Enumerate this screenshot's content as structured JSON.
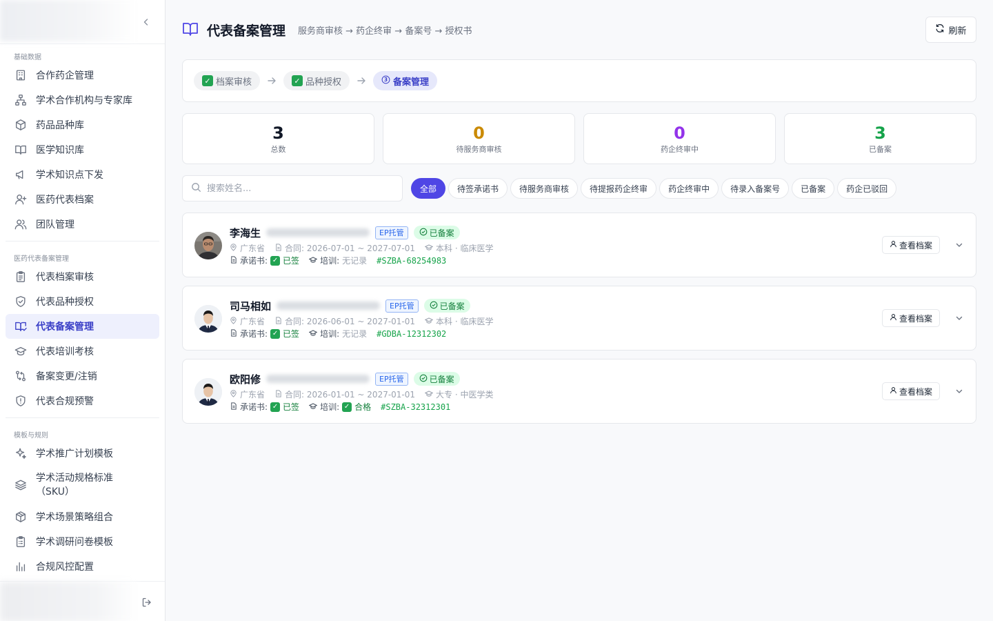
{
  "sidebar": {
    "sections": [
      {
        "title": "基础数据",
        "items": [
          {
            "label": "合作药企管理",
            "icon": "building-icon"
          },
          {
            "label": "学术合作机构与专家库",
            "icon": "network-icon"
          },
          {
            "label": "药品品种库",
            "icon": "package-icon"
          },
          {
            "label": "医学知识库",
            "icon": "book-open-icon"
          },
          {
            "label": "学术知识点下发",
            "icon": "megaphone-icon"
          },
          {
            "label": "医药代表档案",
            "icon": "user-plus-icon"
          },
          {
            "label": "团队管理",
            "icon": "users-icon"
          }
        ]
      },
      {
        "title": "医药代表备案管理",
        "items": [
          {
            "label": "代表档案审核",
            "icon": "clipboard-list-icon"
          },
          {
            "label": "代表品种授权",
            "icon": "shield-check-icon"
          },
          {
            "label": "代表备案管理",
            "icon": "book-check-icon",
            "active": true
          },
          {
            "label": "代表培训考核",
            "icon": "graduation-cap-icon"
          },
          {
            "label": "备案变更/注销",
            "icon": "git-compare-icon"
          },
          {
            "label": "代表合规预警",
            "icon": "shield-alert-icon"
          }
        ]
      },
      {
        "title": "模板与规则",
        "items": [
          {
            "label": "学术推广计划模板",
            "icon": "sparkles-icon"
          },
          {
            "label": "学术活动规格标准（SKU）",
            "icon": "layers-icon"
          },
          {
            "label": "学术场景策略组合",
            "icon": "box-icon"
          },
          {
            "label": "学术调研问卷模板",
            "icon": "clipboard-icon"
          },
          {
            "label": "合规风控配置",
            "icon": "bar-chart-icon"
          }
        ]
      }
    ]
  },
  "header": {
    "title": "代表备案管理",
    "breadcrumb": "服务商审核 → 药企终审 → 备案号 → 授权书",
    "refresh_label": "刷新"
  },
  "steps": [
    {
      "label": "档案审核",
      "state": "done"
    },
    {
      "label": "品种授权",
      "state": "done"
    },
    {
      "label": "备案管理",
      "state": "current",
      "number": "3"
    }
  ],
  "stats": [
    {
      "value": "3",
      "label": "总数",
      "color": "#111827"
    },
    {
      "value": "0",
      "label": "待服务商审核",
      "color": "#ca8a04"
    },
    {
      "value": "0",
      "label": "药企终审中",
      "color": "#9333ea"
    },
    {
      "value": "3",
      "label": "已备案",
      "color": "#16a34a"
    }
  ],
  "search": {
    "placeholder": "搜索姓名..."
  },
  "filters": [
    "全部",
    "待签承诺书",
    "待服务商审核",
    "待提报药企终审",
    "药企终审中",
    "待录入备案号",
    "已备案",
    "药企已驳回"
  ],
  "active_filter": "全部",
  "reps": [
    {
      "name": "李海生",
      "badge": "EP托管",
      "status": "已备案",
      "province": "广东省",
      "contract": "合同: 2026-07-01 ~ 2027-07-01",
      "education": "本科 · 临床医学",
      "pledge_label": "承诺书:",
      "pledge_value": "已签",
      "training_label": "培训:",
      "training_value": "无记录",
      "training_ok": false,
      "code": "#SZBA-68254983",
      "view_label": "查看档案"
    },
    {
      "name": "司马相如",
      "badge": "EP托管",
      "status": "已备案",
      "province": "广东省",
      "contract": "合同: 2026-06-01 ~ 2027-01-01",
      "education": "本科 · 临床医学",
      "pledge_label": "承诺书:",
      "pledge_value": "已签",
      "training_label": "培训:",
      "training_value": "无记录",
      "training_ok": false,
      "code": "#GDBA-12312302",
      "view_label": "查看档案"
    },
    {
      "name": "欧阳修",
      "badge": "EP托管",
      "status": "已备案",
      "province": "广东省",
      "contract": "合同: 2026-01-01 ~ 2027-01-01",
      "education": "大专 · 中医学类",
      "pledge_label": "承诺书:",
      "pledge_value": "已签",
      "training_label": "培训:",
      "training_value": "合格",
      "training_ok": true,
      "code": "#SZBA-32312301",
      "view_label": "查看档案"
    }
  ]
}
